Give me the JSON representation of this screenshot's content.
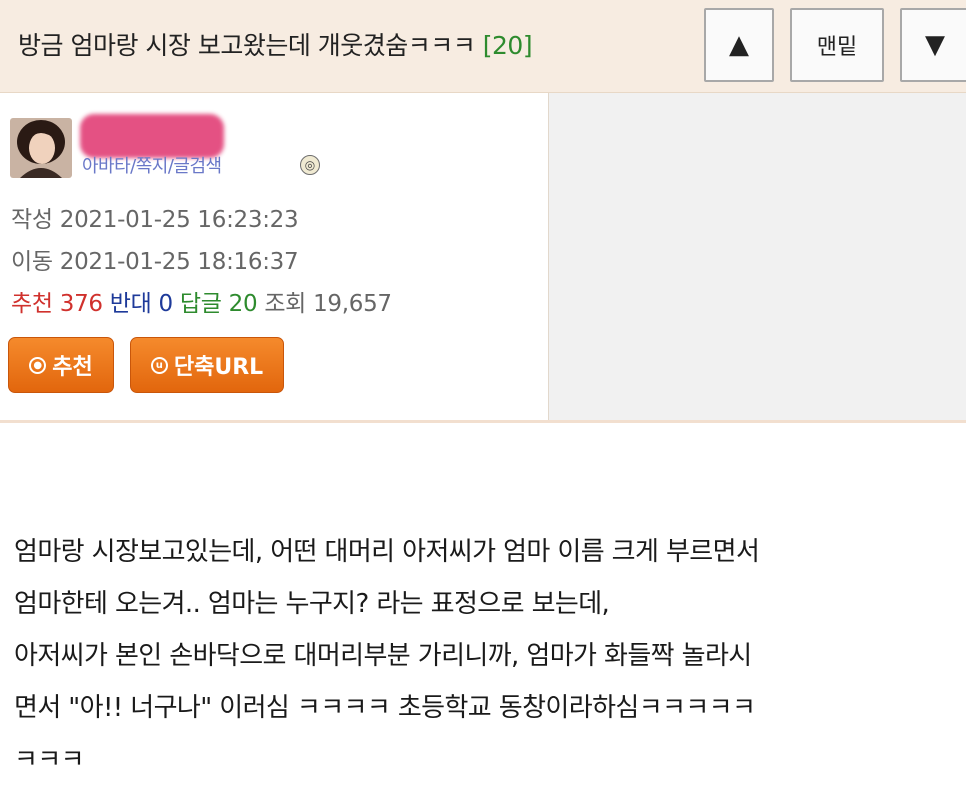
{
  "header": {
    "title": "방금 엄마랑 시장 보고왔는데 개웃겼숨ㅋㅋㅋ",
    "reply_count": "[20]",
    "up_label": "▲",
    "bottom_label": "맨밑",
    "down_label": "▼"
  },
  "author": {
    "links": "아바타/쪽지/글검색",
    "badge_icon": "member-level-icon"
  },
  "meta": {
    "created_label": "작성",
    "created": "2021-01-25 16:23:23",
    "moved_label": "이동",
    "moved": "2021-01-25 18:16:37"
  },
  "stats": {
    "recommend_label": "추천",
    "recommend": "376",
    "oppose_label": "반대",
    "oppose": "0",
    "replies_label": "답글",
    "replies": "20",
    "views_label": "조회",
    "views": "19,657"
  },
  "actions": {
    "recommend_label": "추천",
    "short_url_label": "단축URL"
  },
  "body": {
    "lines": [
      "엄마랑 시장보고있는데, 어떤 대머리 아저씨가 엄마 이름 크게 부르면서",
      "엄마한테 오는겨.. 엄마는 누구지? 라는 표정으로 보는데,",
      "아저씨가 본인 손바닥으로 대머리부분 가리니까, 엄마가 화들짝 놀라시",
      "면서 \"아!! 너구나\" 이러심 ㅋㅋㅋㅋ 초등학교 동창이라하심ㅋㅋㅋㅋㅋ",
      "ㅋㅋㅋ"
    ]
  },
  "colors": {
    "header_bg": "#f7ece1",
    "recommend": "#d0312d",
    "oppose": "#1e3a9a",
    "replies": "#2e8b2e",
    "button_orange": "#f07a1e",
    "link": "#6a78c8"
  }
}
